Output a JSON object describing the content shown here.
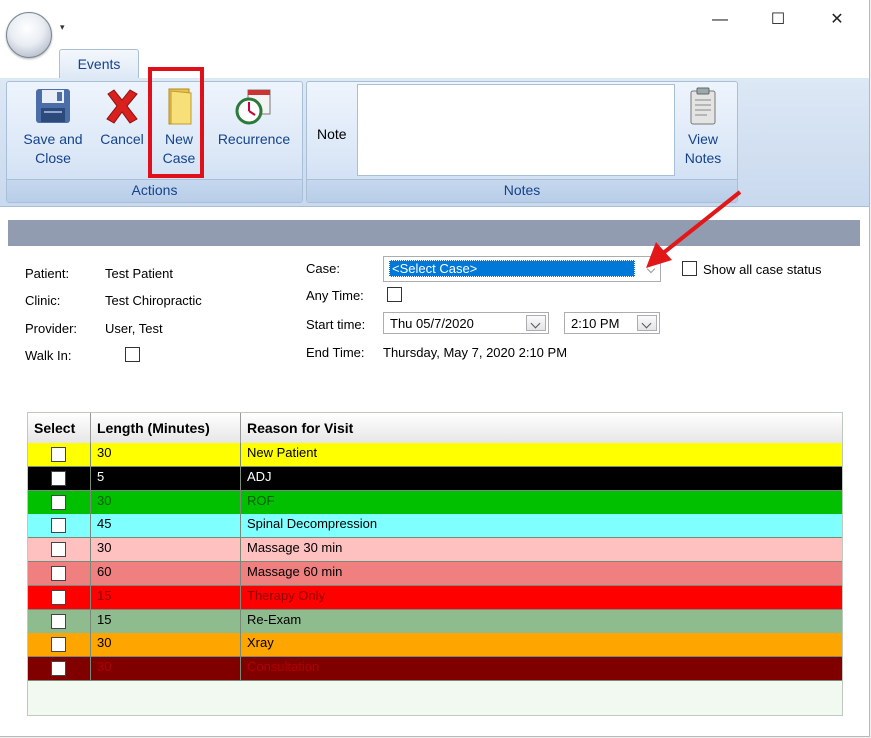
{
  "window": {
    "minimize_glyph": "—",
    "maximize_glyph": "☐",
    "close_glyph": "✕",
    "qat_glyph": "▾"
  },
  "ribbon": {
    "tab": "Events",
    "groups": {
      "actions": {
        "label": "Actions",
        "save": {
          "line1": "Save and",
          "line2": "Close",
          "icon": "floppy-disk-icon"
        },
        "cancel": {
          "line1": "Cancel",
          "icon": "red-x-icon"
        },
        "new_case": {
          "line1": "New",
          "line2": "Case",
          "icon": "folder-icon"
        },
        "recurrence": {
          "line1": "Recurrence",
          "icon": "calendar-clock-icon"
        }
      },
      "notes": {
        "label": "Notes",
        "note_label": "Note",
        "note_value": "",
        "view_notes": {
          "line1": "View",
          "line2": "Notes",
          "icon": "clipboard-icon"
        }
      }
    }
  },
  "appointment": {
    "patient_label": "Patient:",
    "patient": "Test Patient",
    "clinic_label": "Clinic:",
    "clinic": "Test Chiropractic",
    "provider_label": "Provider:",
    "provider": "User, Test",
    "walkin_label": "Walk In:",
    "case_label": "Case:",
    "case_value": "<Select Case>",
    "show_all_label": "Show all case status",
    "anytime_label": "Any Time:",
    "start_label": "Start time:",
    "start_date": "Thu 05/7/2020",
    "start_time": "2:10 PM",
    "end_label": "End Time:",
    "end_value": "Thursday, May 7, 2020 2:10 PM"
  },
  "visits": {
    "columns": [
      "Select",
      "Length (Minutes)",
      "Reason for Visit"
    ],
    "rows": [
      {
        "length": "30",
        "reason": "New Patient",
        "bg": "#ffff00",
        "fg": "#000000"
      },
      {
        "length": "5",
        "reason": "ADJ",
        "bg": "#000000",
        "fg": "#ffffff"
      },
      {
        "length": "30",
        "reason": "ROF",
        "bg": "#00c000",
        "fg": "#006000"
      },
      {
        "length": "45",
        "reason": "Spinal Decompression",
        "bg": "#80ffff",
        "fg": "#000000"
      },
      {
        "length": "30",
        "reason": "Massage 30 min",
        "bg": "#ffc0c0",
        "fg": "#000000"
      },
      {
        "length": "60",
        "reason": "Massage 60 min",
        "bg": "#f08080",
        "fg": "#000000"
      },
      {
        "length": "15",
        "reason": "Therapy Only",
        "bg": "#ff0000",
        "fg": "#900000"
      },
      {
        "length": "15",
        "reason": "Re-Exam",
        "bg": "#8fbc8f",
        "fg": "#000000"
      },
      {
        "length": "30",
        "reason": "Xray",
        "bg": "#ffa500",
        "fg": "#000000"
      },
      {
        "length": "30",
        "reason": "Consultation",
        "bg": "#800000",
        "fg": "#b00000"
      }
    ]
  }
}
